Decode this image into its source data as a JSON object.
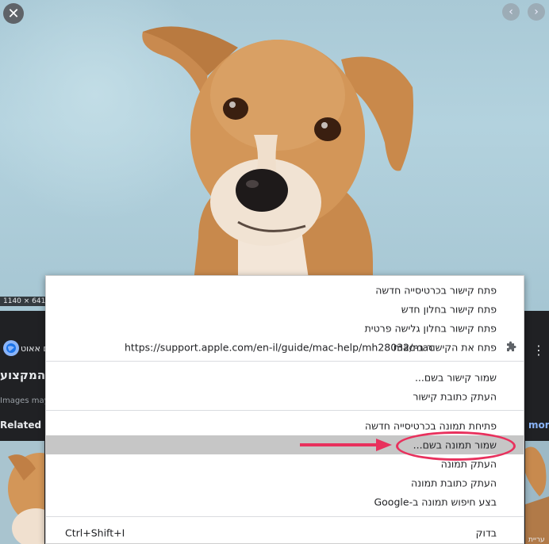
{
  "viewer": {
    "close_icon": "close-icon",
    "prev_icon": "chevron-left-icon",
    "next_icon": "chevron-right-icon",
    "dimensions": "1140 × 641",
    "close_glyph": "✕",
    "prev_glyph": "‹",
    "next_glyph": "›"
  },
  "panel": {
    "site_name": "ם אאוט",
    "title": "המקצוע",
    "images_note": "Images may",
    "related_label": "Related im",
    "more_link": "more",
    "thumb_caption": "עריית",
    "dots_glyph": "⋮"
  },
  "context_menu": {
    "groups": [
      [
        {
          "label": "פתח קישור בכרטיסייה חדשה"
        },
        {
          "label": "פתח קישור בחלון חדש"
        },
        {
          "label": "פתח קישור בחלון גלישה פרטית"
        },
        {
          "label": "פתח את הקישור ב-mac",
          "url": "https://support.apple.com/en-il/guide/mac-help/mh28032/mac",
          "icon": "puzzle-extension-icon"
        }
      ],
      [
        {
          "label": "שמור קישור בשם..."
        },
        {
          "label": "העתק כתובת קישור"
        }
      ],
      [
        {
          "label": "פתיחת תמונה בכרטיסייה חדשה"
        },
        {
          "label": "שמור תמונה בשם...",
          "highlighted": true
        },
        {
          "label": "העתק תמונה"
        },
        {
          "label": "העתק כתובת תמונה"
        },
        {
          "label": "בצע חיפוש תמונה ב-Google"
        }
      ],
      [
        {
          "label": "בדוק",
          "shortcut": "Ctrl+Shift+I"
        }
      ]
    ]
  },
  "annotation": {
    "color": "#e8315d"
  },
  "colors": {
    "panel_bg": "#202124",
    "menu_bg": "#ffffff",
    "highlight": "#c6c6c6",
    "link_blue": "#8ab4f8"
  }
}
